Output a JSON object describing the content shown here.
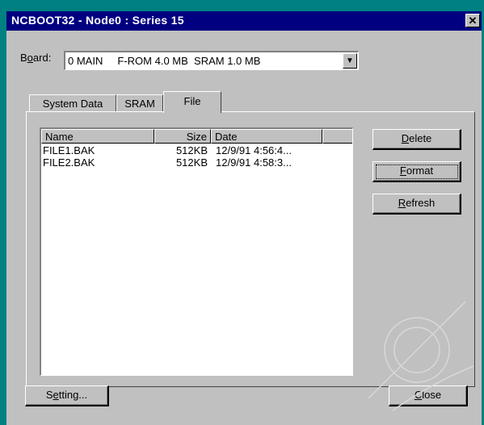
{
  "window": {
    "title": "NCBOOT32 - Node0 : Series 15",
    "close_glyph": "✕"
  },
  "board": {
    "label_prefix": "B",
    "label_ul": "o",
    "label_suffix": "ard:",
    "selected_value": "0 MAIN     F-ROM 4.0 MB  SRAM 1.0 MB",
    "arrow_glyph": "▼"
  },
  "tabs": [
    {
      "label": "System Data"
    },
    {
      "label": "SRAM"
    },
    {
      "label": "File"
    }
  ],
  "file_list": {
    "columns": [
      "Name",
      "Size",
      "Date"
    ],
    "rows": [
      {
        "name": "FILE1.BAK",
        "size": "512KB",
        "date": "12/9/91 4:56:4..."
      },
      {
        "name": "FILE2.BAK",
        "size": "512KB",
        "date": "12/9/91 4:58:3..."
      }
    ]
  },
  "side_buttons": {
    "delete": {
      "ul": "D",
      "rest": "elete"
    },
    "format": {
      "ul": "F",
      "rest": "ormat"
    },
    "refresh": {
      "ul": "R",
      "rest": "efresh"
    }
  },
  "bottom_buttons": {
    "setting": {
      "pre": "S",
      "ul": "e",
      "rest": "tting..."
    },
    "close": {
      "ul": "C",
      "rest": "lose"
    }
  }
}
